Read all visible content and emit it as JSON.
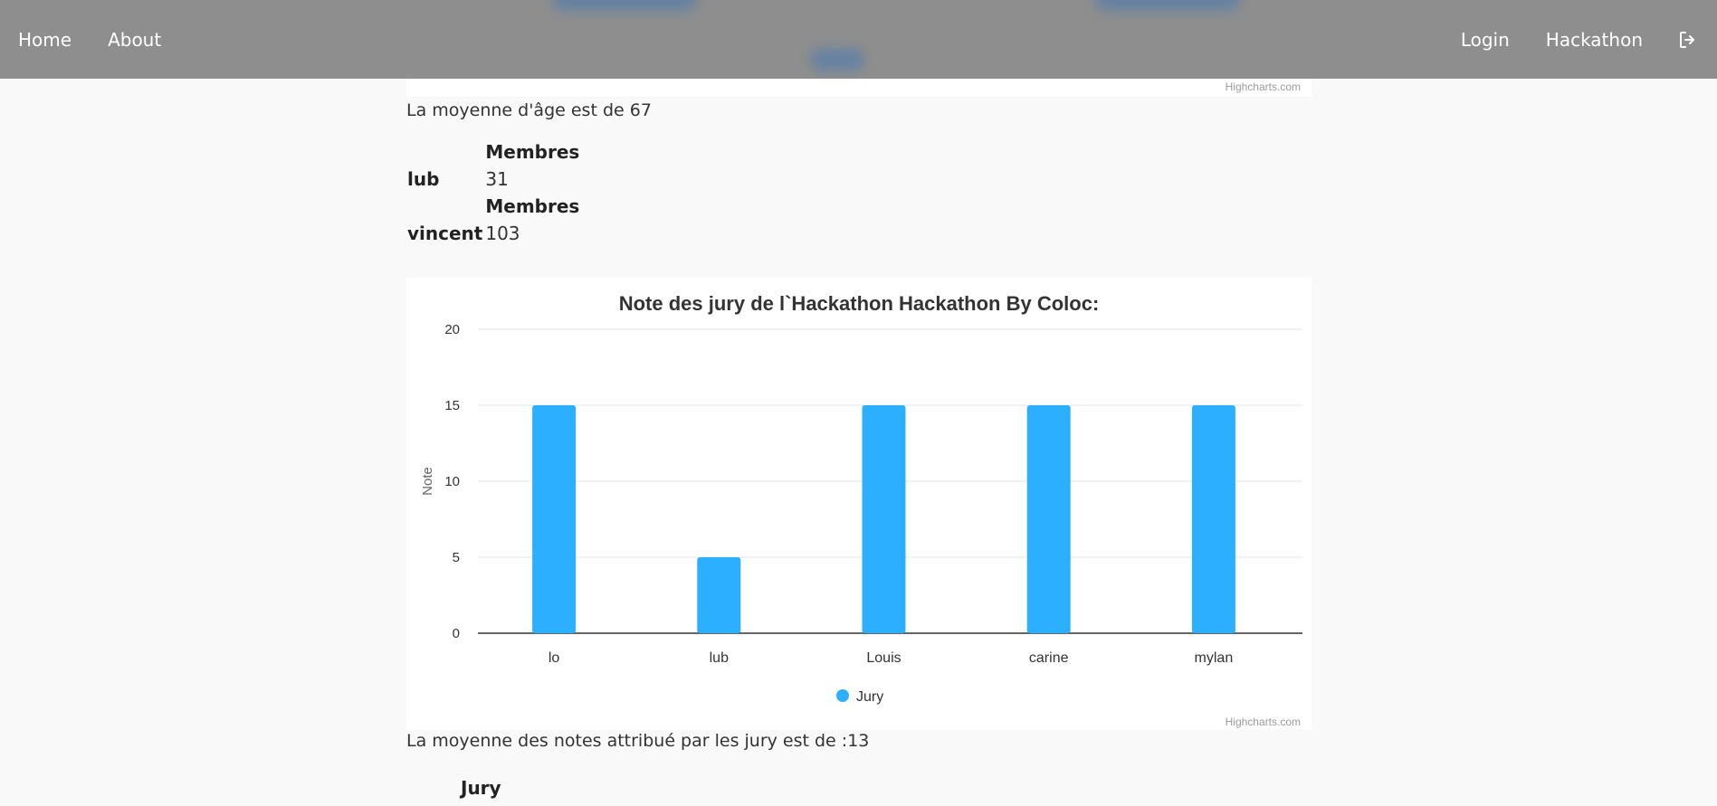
{
  "nav": {
    "home": "Home",
    "about": "About",
    "login": "Login",
    "hackathon": "Hackathon",
    "logout_icon": "logout-icon"
  },
  "credits_top": "Highcharts.com",
  "age_average_text": "La moyenne d'âge est de 67",
  "members_table": {
    "header": "Membres",
    "rows": [
      {
        "name": "lub",
        "value": "31"
      },
      {
        "name": "vincent",
        "value": "103"
      }
    ]
  },
  "chart_data": {
    "type": "bar",
    "title": "Note des jury de l`Hackathon Hackathon By Coloc:",
    "xlabel": "",
    "ylabel": "Note",
    "categories": [
      "lo",
      "lub",
      "Louis",
      "carine",
      "mylan"
    ],
    "series": [
      {
        "name": "Jury",
        "values": [
          15,
          5,
          15,
          15,
          15
        ],
        "color": "#2caffe"
      }
    ],
    "ylim": [
      0,
      20
    ],
    "yticks": [
      0,
      5,
      10,
      15,
      20
    ],
    "grid": true,
    "legend": "bottom-center",
    "credits": "Highcharts.com"
  },
  "notes_average_text": "La moyenne des notes attribué par les jury est de :13",
  "jury_header": "Jury"
}
